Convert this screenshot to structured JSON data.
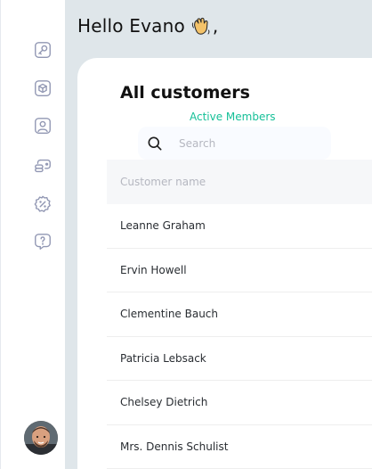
{
  "header": {
    "greeting": "Hello Evano",
    "greeting_suffix": ",",
    "wave_icon": "waving-hand-icon"
  },
  "sidebar": {
    "items": [
      {
        "icon": "key-icon"
      },
      {
        "icon": "cube-icon"
      },
      {
        "icon": "user-square-icon"
      },
      {
        "icon": "wallet-icon"
      },
      {
        "icon": "discount-badge-icon"
      },
      {
        "icon": "help-message-icon"
      }
    ],
    "avatar": "user-avatar"
  },
  "customers": {
    "title": "All customers",
    "subtitle": "Active Members",
    "search": {
      "placeholder": "Search",
      "value": ""
    },
    "columns": [
      "Customer name"
    ],
    "rows": [
      {
        "name": "Leanne Graham"
      },
      {
        "name": "Ervin Howell"
      },
      {
        "name": "Clementine Bauch"
      },
      {
        "name": "Patricia Lebsack"
      },
      {
        "name": "Chelsey Dietrich"
      },
      {
        "name": "Mrs. Dennis Schulist"
      }
    ]
  },
  "colors": {
    "background": "#dfe6ea",
    "card": "#ffffff",
    "accent_green": "#16c098",
    "muted_text": "#b5b7c0",
    "icon_stroke": "#9197b3"
  }
}
